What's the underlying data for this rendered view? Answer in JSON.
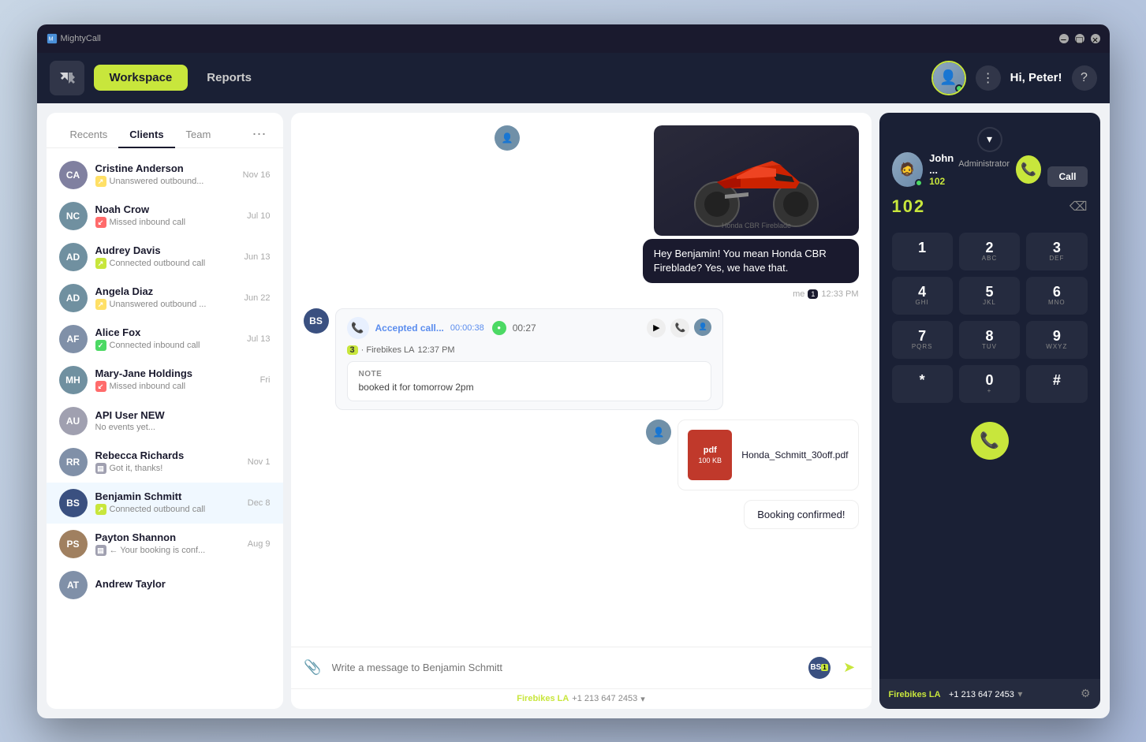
{
  "app": {
    "title": "MightyCall",
    "titlebar_buttons": [
      "minimize",
      "maximize",
      "close"
    ]
  },
  "nav": {
    "workspace_label": "Workspace",
    "reports_label": "Reports",
    "greeting": "Hi, Peter!"
  },
  "contacts": {
    "tabs": [
      "Recents",
      "Clients",
      "Team"
    ],
    "active_tab": "Clients",
    "items": [
      {
        "initials": "CA",
        "color": "#8080a0",
        "name": "Cristine Anderson",
        "status": "Unanswered outbound...",
        "status_type": "outbound-unanswered",
        "date": "Nov 16"
      },
      {
        "initials": "NC",
        "color": "#7090a0",
        "name": "Noah Crow",
        "status": "Missed inbound call",
        "status_type": "inbound-missed",
        "date": "Jul 10"
      },
      {
        "initials": "AD",
        "color": "#7090a0",
        "name": "Audrey Davis",
        "status": "Connected outbound call",
        "status_type": "outbound-connected",
        "date": "Jun 13"
      },
      {
        "initials": "AD",
        "color": "#7090a0",
        "name": "Angela Diaz",
        "status": "Unanswered outbound ...",
        "status_type": "outbound-unanswered",
        "date": "Jun 22"
      },
      {
        "initials": "AF",
        "color": "#8090a8",
        "name": "Alice Fox",
        "status": "Connected inbound call",
        "status_type": "inbound-connected",
        "date": "Jul 13"
      },
      {
        "initials": "MH",
        "color": "#7090a0",
        "name": "Mary-Jane Holdings",
        "status": "Missed inbound call",
        "status_type": "inbound-missed",
        "date": "Fri"
      },
      {
        "initials": "AU",
        "color": "#a0a0b0",
        "name": "API User NEW",
        "status": "No events yet...",
        "status_type": "none",
        "date": ""
      },
      {
        "initials": "RR",
        "color": "#8090a8",
        "name": "Rebecca Richards",
        "status": "Got it, thanks!",
        "status_type": "message",
        "date": "Nov 1"
      },
      {
        "initials": "BS",
        "color": "#3a5080",
        "name": "Benjamin Schmitt",
        "status": "Connected outbound call",
        "status_type": "outbound-connected",
        "date": "Dec 8"
      },
      {
        "initials": "PS",
        "color": "#a08060",
        "name": "Payton Shannon",
        "status": "← Your booking is conf...",
        "status_type": "message",
        "date": "Aug 9"
      },
      {
        "initials": "AT",
        "color": "#8090a8",
        "name": "Andrew Taylor",
        "status": "",
        "status_type": "none",
        "date": ""
      }
    ]
  },
  "chat": {
    "contact_name": "Benjamin Schmitt",
    "messages": [
      {
        "id": "msg1",
        "type": "image+text",
        "side": "right",
        "image_alt": "Red motorcycle Honda CBR Fireblade",
        "text": "Hey Benjamin! You mean Honda CBR Fireblade? Yes, we have that.",
        "meta_me": "me",
        "meta_badge": "1",
        "meta_time": "12:33 PM"
      },
      {
        "id": "msg2",
        "type": "call+note",
        "side": "left",
        "avatar_initials": "BS",
        "avatar_color": "#3a5080",
        "call_text": "Accepted call...",
        "call_time": "00:00:38",
        "call_duration": "00:27",
        "firebikes_num": "3",
        "firebikes_label": "Firebikes LA",
        "call_timestamp": "12:37 PM",
        "note_label": "NOTE",
        "note_text": "booked it for tomorrow 2pm"
      },
      {
        "id": "msg3",
        "type": "pdf",
        "side": "right",
        "pdf_label": "pdf",
        "pdf_size": "100 KB",
        "pdf_name": "Honda_Schmitt_30off.pdf"
      },
      {
        "id": "msg4",
        "type": "text",
        "side": "right",
        "text": "Booking confirmed!"
      }
    ],
    "input_placeholder": "Write a message to Benjamin Schmitt",
    "footer_label": "Firebikes LA",
    "footer_number": "+1 213 647 2453"
  },
  "dialer": {
    "user_name": "John ...",
    "user_role": "Administrator",
    "user_ext": "102",
    "call_label": "Call",
    "input_number": "102",
    "keys": [
      {
        "digit": "1",
        "sub": ""
      },
      {
        "digit": "2",
        "sub": "ABC"
      },
      {
        "digit": "3",
        "sub": "DEF"
      },
      {
        "digit": "4",
        "sub": "GHI"
      },
      {
        "digit": "5",
        "sub": "JKL"
      },
      {
        "digit": "6",
        "sub": "MNO"
      },
      {
        "digit": "7",
        "sub": "PQRS"
      },
      {
        "digit": "8",
        "sub": "TUV"
      },
      {
        "digit": "9",
        "sub": "WXYZ"
      },
      {
        "digit": "*",
        "sub": ""
      },
      {
        "digit": "0",
        "sub": "+"
      },
      {
        "digit": "#",
        "sub": ""
      }
    ],
    "footer_label": "Firebikes LA",
    "footer_number": "+1 213 647 2453"
  }
}
